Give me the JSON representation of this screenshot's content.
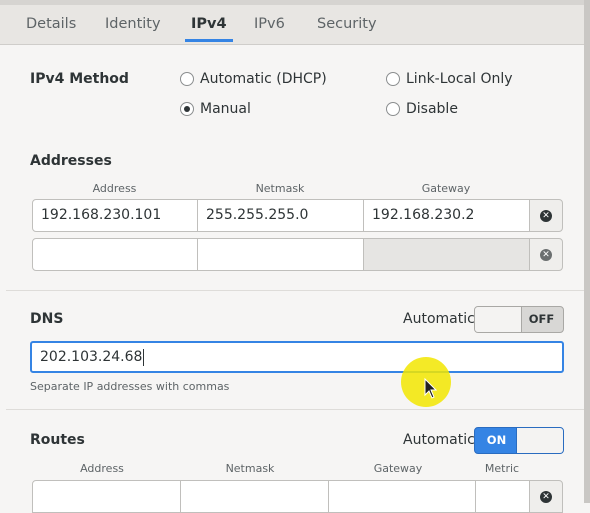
{
  "tabs": [
    "Details",
    "Identity",
    "IPv4",
    "IPv6",
    "Security"
  ],
  "active_tab": "IPv4",
  "method": {
    "label": "IPv4 Method",
    "options": [
      "Automatic (DHCP)",
      "Link-Local Only",
      "Manual",
      "Disable"
    ],
    "selected": "Manual"
  },
  "addresses": {
    "title": "Addresses",
    "headers": [
      "Address",
      "Netmask",
      "Gateway"
    ],
    "rows": [
      [
        "192.168.230.101",
        "255.255.255.0",
        "192.168.230.2"
      ],
      [
        "",
        "",
        ""
      ]
    ]
  },
  "dns": {
    "title": "DNS",
    "automatic_label": "Automatic",
    "switch_state": "OFF",
    "value": "202.103.24.68",
    "hint": "Separate IP addresses with commas"
  },
  "routes": {
    "title": "Routes",
    "automatic_label": "Automatic",
    "switch_state": "ON",
    "headers": [
      "Address",
      "Netmask",
      "Gateway",
      "Metric"
    ]
  },
  "colors": {
    "accent": "#3584e4",
    "pointer": "#f2e600"
  },
  "icons": {
    "delete": "circle-x-icon"
  }
}
